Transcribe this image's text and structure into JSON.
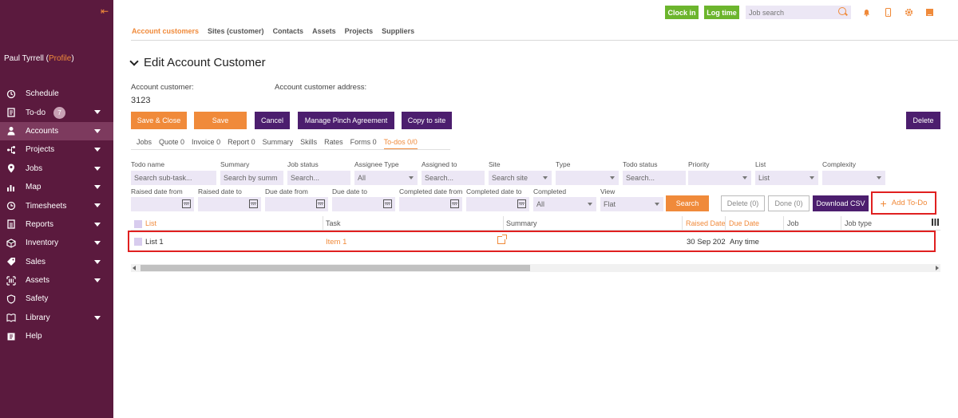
{
  "sidebar": {
    "collapse_icon": "arrow-left-icon",
    "user_name": "Paul Tyrrell",
    "profile_link": "Profile",
    "items": [
      {
        "label": "Schedule",
        "icon": "schedule-icon"
      },
      {
        "label": "To-do",
        "icon": "todo-icon",
        "badge": "7"
      },
      {
        "label": "Accounts",
        "icon": "user-icon"
      },
      {
        "label": "Projects",
        "icon": "projects-icon"
      },
      {
        "label": "Jobs",
        "icon": "pin-icon"
      },
      {
        "label": "Map",
        "icon": "map-icon"
      },
      {
        "label": "Timesheets",
        "icon": "clock-icon"
      },
      {
        "label": "Reports",
        "icon": "reports-icon"
      },
      {
        "label": "Inventory",
        "icon": "box-icon"
      },
      {
        "label": "Sales",
        "icon": "tag-icon"
      },
      {
        "label": "Assets",
        "icon": "assets-icon"
      },
      {
        "label": "Safety",
        "icon": "shield-icon"
      },
      {
        "label": "Library",
        "icon": "book-icon"
      },
      {
        "label": "Help",
        "icon": "help-icon"
      }
    ]
  },
  "topbar": {
    "clock_in": "Clock in",
    "log_time": "Log time",
    "job_search_placeholder": "Job search"
  },
  "main_tabs": [
    "Account customers",
    "Sites (customer)",
    "Contacts",
    "Assets",
    "Projects",
    "Suppliers"
  ],
  "page": {
    "title": "Edit Account Customer",
    "account_customer_label": "Account customer:",
    "account_customer_value": "3123",
    "address_label": "Account customer address:"
  },
  "actions": {
    "save_close": "Save & Close",
    "save": "Save",
    "cancel": "Cancel",
    "manage_pinch": "Manage Pinch Agreement",
    "copy_to_site": "Copy to site",
    "delete": "Delete"
  },
  "sub_tabs": [
    "Jobs",
    "Quote 0",
    "Invoice 0",
    "Report 0",
    "Summary",
    "Skills",
    "Rates",
    "Forms 0",
    "To-dos 0/0"
  ],
  "filters": {
    "todo_name": {
      "label": "Todo name",
      "placeholder": "Search sub-task..."
    },
    "summary": {
      "label": "Summary",
      "placeholder": "Search by summ"
    },
    "job_status": {
      "label": "Job status",
      "placeholder": "Search..."
    },
    "assignee_type": {
      "label": "Assignee Type",
      "value": "All"
    },
    "assigned_to": {
      "label": "Assigned to",
      "placeholder": "Search..."
    },
    "site": {
      "label": "Site",
      "placeholder": "Search site"
    },
    "type": {
      "label": "Type",
      "value": ""
    },
    "todo_status": {
      "label": "Todo status",
      "placeholder": "Search..."
    },
    "priority": {
      "label": "Priority",
      "value": ""
    },
    "list": {
      "label": "List",
      "value": "List"
    },
    "complexity": {
      "label": "Complexity",
      "value": ""
    },
    "raised_from": "Raised date from",
    "raised_to": "Raised date to",
    "due_from": "Due date from",
    "due_to": "Due date to",
    "completed_from": "Completed date from",
    "completed_to": "Completed date to",
    "completed": {
      "label": "Completed",
      "value": "All"
    },
    "view": {
      "label": "View",
      "value": "Flat"
    }
  },
  "filter_buttons": {
    "search": "Search",
    "delete": "Delete (0)",
    "done": "Done (0)",
    "download_csv": "Download CSV",
    "add_todo": "Add To-Do"
  },
  "table": {
    "columns": [
      "List",
      "Task",
      "Summary",
      "Raised Date",
      "Due Date",
      "Job",
      "Job type"
    ],
    "rows": [
      {
        "list": "List 1",
        "task": "Item 1",
        "summary": "",
        "raised": "30 Sep 202",
        "due": "Any time",
        "job": "",
        "job_type": ""
      }
    ]
  },
  "colors": {
    "accent": "#f08a3a",
    "sidebar": "#5b1a3e",
    "purple_btn": "#4c1e6e",
    "green": "#6cb52d",
    "highlight": "#e02020"
  }
}
